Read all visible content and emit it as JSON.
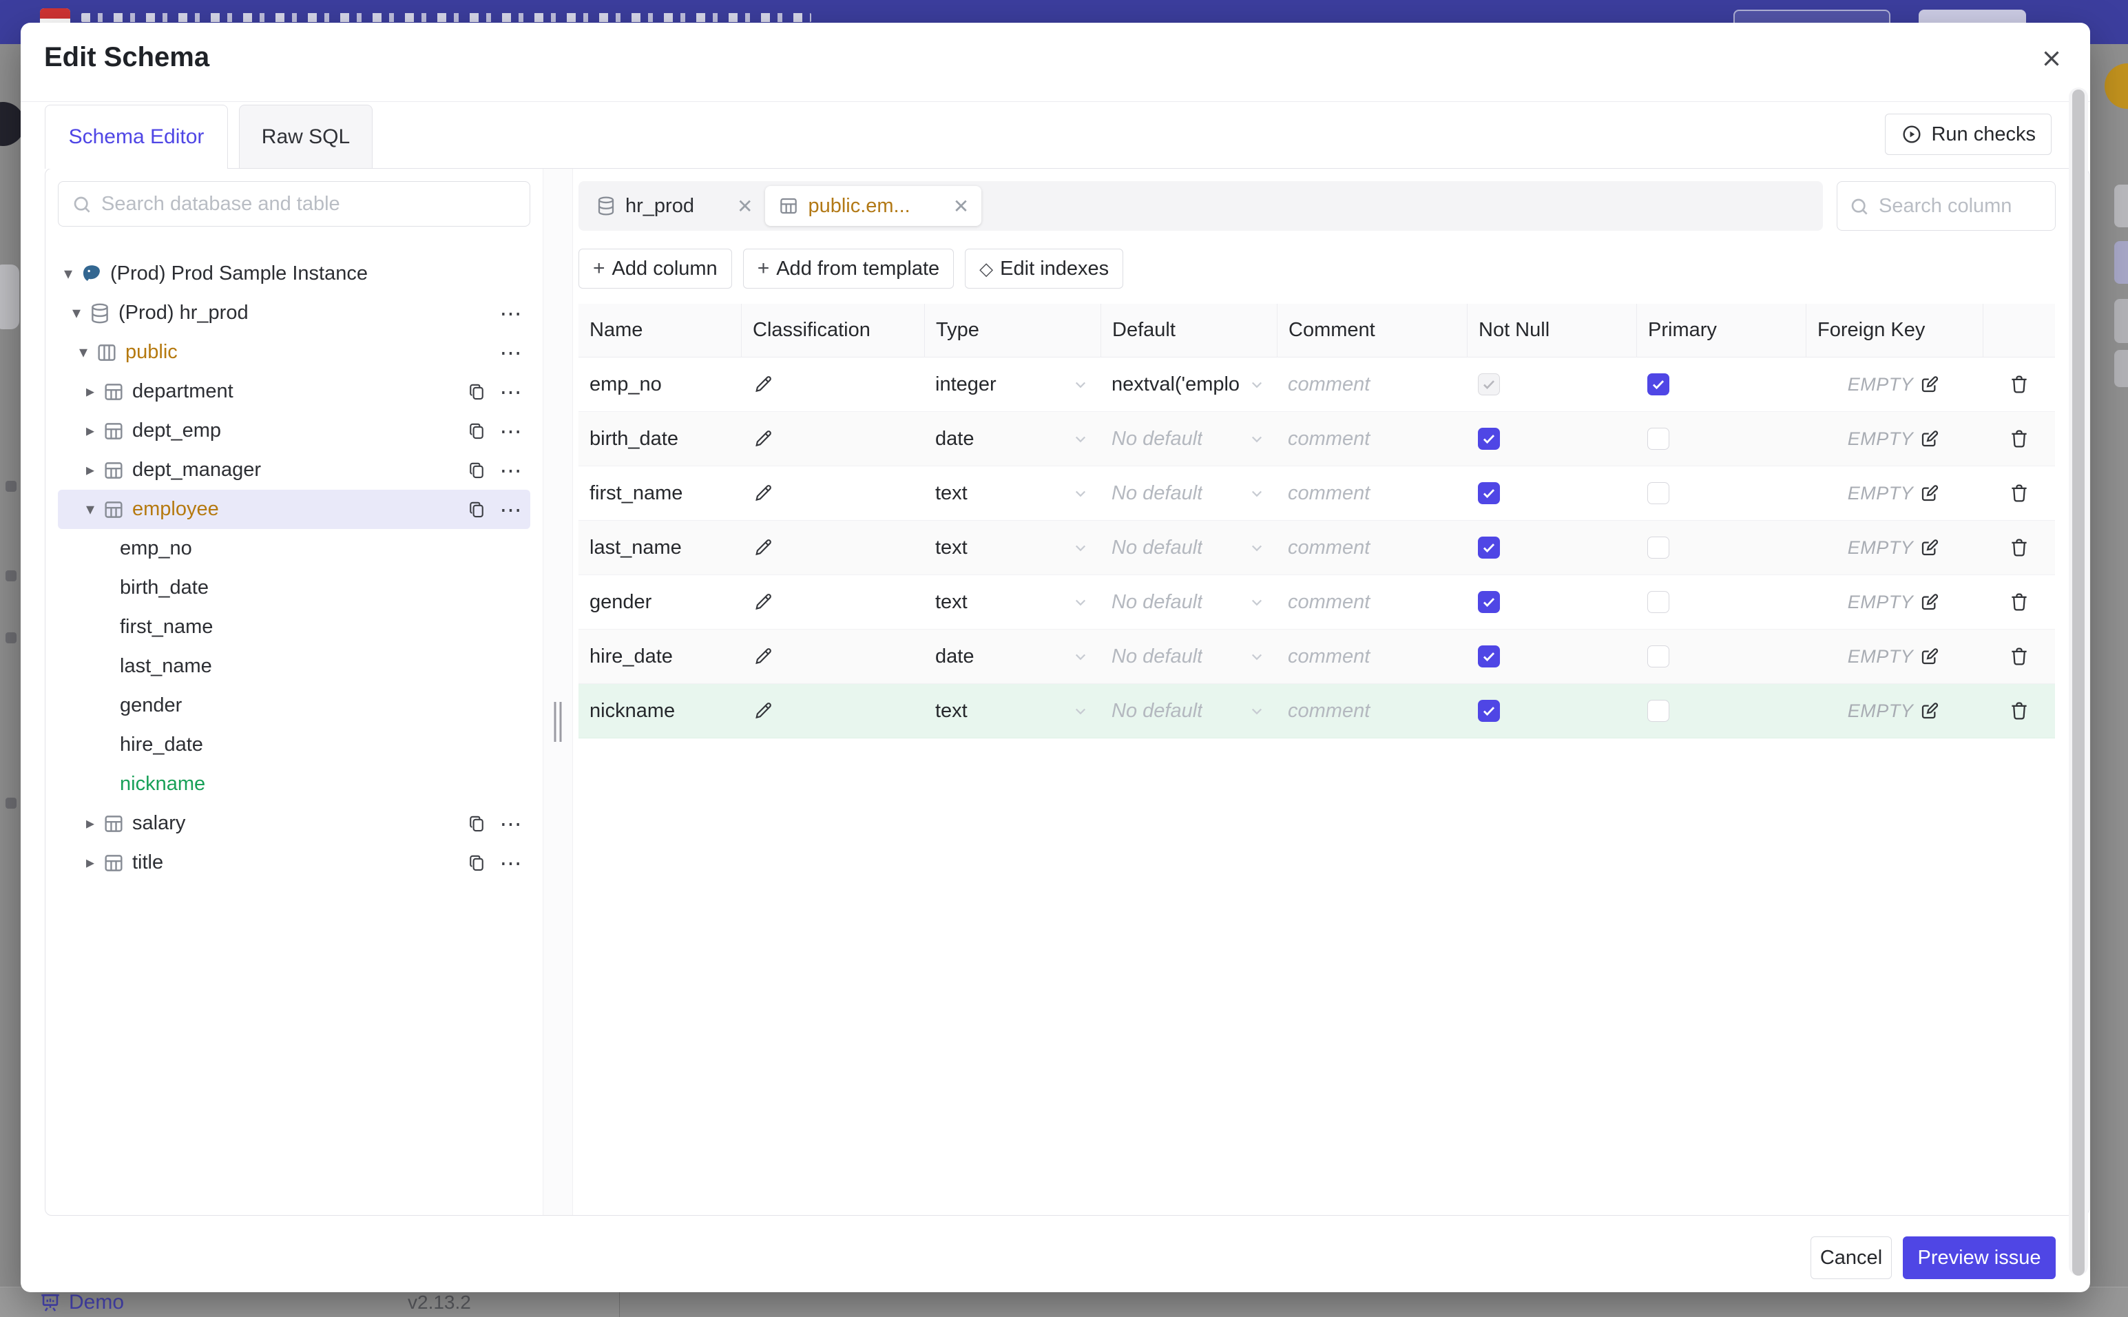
{
  "modal": {
    "title": "Edit Schema"
  },
  "tabs": [
    {
      "label": "Schema Editor",
      "active": true
    },
    {
      "label": "Raw SQL",
      "active": false
    }
  ],
  "run_checks": {
    "label": "Run checks"
  },
  "sidebar": {
    "search_placeholder": "Search database and table",
    "tree": [
      {
        "id": "prod-sample-instance",
        "label": "(Prod) Prod Sample Instance",
        "level": 1,
        "type": "instance",
        "icon": "pg",
        "arrow": "down"
      },
      {
        "id": "hr-prod",
        "label": "(Prod) hr_prod",
        "level": 2,
        "type": "database",
        "icon": "db",
        "arrow": "down",
        "dots": true
      },
      {
        "id": "public",
        "label": "public",
        "level": 3,
        "type": "schema",
        "icon": "schema",
        "arrow": "down",
        "dots": true,
        "color": "#b5790f"
      },
      {
        "id": "department",
        "label": "department",
        "level": 4,
        "type": "table",
        "icon": "table",
        "arrow": "right",
        "copy": true,
        "dots": true
      },
      {
        "id": "dept-emp",
        "label": "dept_emp",
        "level": 4,
        "type": "table",
        "icon": "table",
        "arrow": "right",
        "copy": true,
        "dots": true
      },
      {
        "id": "dept-manager",
        "label": "dept_manager",
        "level": 4,
        "type": "table",
        "icon": "table",
        "arrow": "right",
        "copy": true,
        "dots": true
      },
      {
        "id": "employee",
        "label": "employee",
        "level": 4,
        "type": "table",
        "icon": "table",
        "arrow": "down",
        "copy": true,
        "dots": true,
        "selected": true,
        "color": "#b5790f"
      },
      {
        "id": "emp-no",
        "label": "emp_no",
        "type": "column"
      },
      {
        "id": "birth-date",
        "label": "birth_date",
        "type": "column"
      },
      {
        "id": "first-name",
        "label": "first_name",
        "type": "column"
      },
      {
        "id": "last-name",
        "label": "last_name",
        "type": "column"
      },
      {
        "id": "gender",
        "label": "gender",
        "type": "column"
      },
      {
        "id": "hire-date",
        "label": "hire_date",
        "type": "column"
      },
      {
        "id": "nickname",
        "label": "nickname",
        "type": "column",
        "color": "#18a058"
      },
      {
        "id": "salary",
        "label": "salary",
        "level": 4,
        "type": "table",
        "icon": "table",
        "arrow": "right",
        "copy": true,
        "dots": true
      },
      {
        "id": "title",
        "label": "title",
        "level": 4,
        "type": "table",
        "icon": "table",
        "arrow": "right",
        "copy": true,
        "dots": true
      }
    ]
  },
  "main": {
    "chips": [
      {
        "label": "hr_prod",
        "icon": "database",
        "active": false
      },
      {
        "label": "public.em...",
        "icon": "table",
        "active": true
      }
    ],
    "search_placeholder": "Search column",
    "buttons": [
      {
        "icon": "+",
        "label": "Add column"
      },
      {
        "icon": "+",
        "label": "Add from template"
      },
      {
        "icon": "◇",
        "label": "Edit indexes"
      }
    ]
  },
  "table": {
    "headers": [
      "Name",
      "Classification",
      "Type",
      "Default",
      "Comment",
      "Not Null",
      "Primary",
      "Foreign Key"
    ],
    "comment_placeholder": "comment",
    "fk_placeholder": "EMPTY",
    "rows": [
      {
        "name": "emp_no",
        "type": "integer",
        "default": "nextval('employ",
        "default_is_placeholder": false,
        "not_null": "checked-disabled",
        "primary": "checked",
        "foreign_key": "EMPTY",
        "highlight": "none"
      },
      {
        "name": "birth_date",
        "type": "date",
        "default": "No default",
        "default_is_placeholder": true,
        "not_null": "checked",
        "primary": "unchecked",
        "foreign_key": "EMPTY",
        "highlight": "alt"
      },
      {
        "name": "first_name",
        "type": "text",
        "default": "No default",
        "default_is_placeholder": true,
        "not_null": "checked",
        "primary": "unchecked",
        "foreign_key": "EMPTY",
        "highlight": "none"
      },
      {
        "name": "last_name",
        "type": "text",
        "default": "No default",
        "default_is_placeholder": true,
        "not_null": "checked",
        "primary": "unchecked",
        "foreign_key": "EMPTY",
        "highlight": "alt"
      },
      {
        "name": "gender",
        "type": "text",
        "default": "No default",
        "default_is_placeholder": true,
        "not_null": "checked",
        "primary": "unchecked",
        "foreign_key": "EMPTY",
        "highlight": "none"
      },
      {
        "name": "hire_date",
        "type": "date",
        "default": "No default",
        "default_is_placeholder": true,
        "not_null": "checked",
        "primary": "unchecked",
        "foreign_key": "EMPTY",
        "highlight": "alt"
      },
      {
        "name": "nickname",
        "type": "text",
        "default": "No default",
        "default_is_placeholder": true,
        "not_null": "checked",
        "primary": "unchecked",
        "foreign_key": "EMPTY",
        "highlight": "new"
      }
    ]
  },
  "footer": {
    "cancel_label": "Cancel",
    "preview_label": "Preview issue"
  },
  "page_footer": {
    "demo_label": "Demo",
    "version": "v2.13.2"
  },
  "colors": {
    "accent": "#4f46e5",
    "banner": "#3c3e9e",
    "entity_name_amber": "#b5790f",
    "new_column_green": "#18a058",
    "new_row_bg": "#e8f6ee",
    "selected_tree_bg": "#e9e9f9"
  }
}
